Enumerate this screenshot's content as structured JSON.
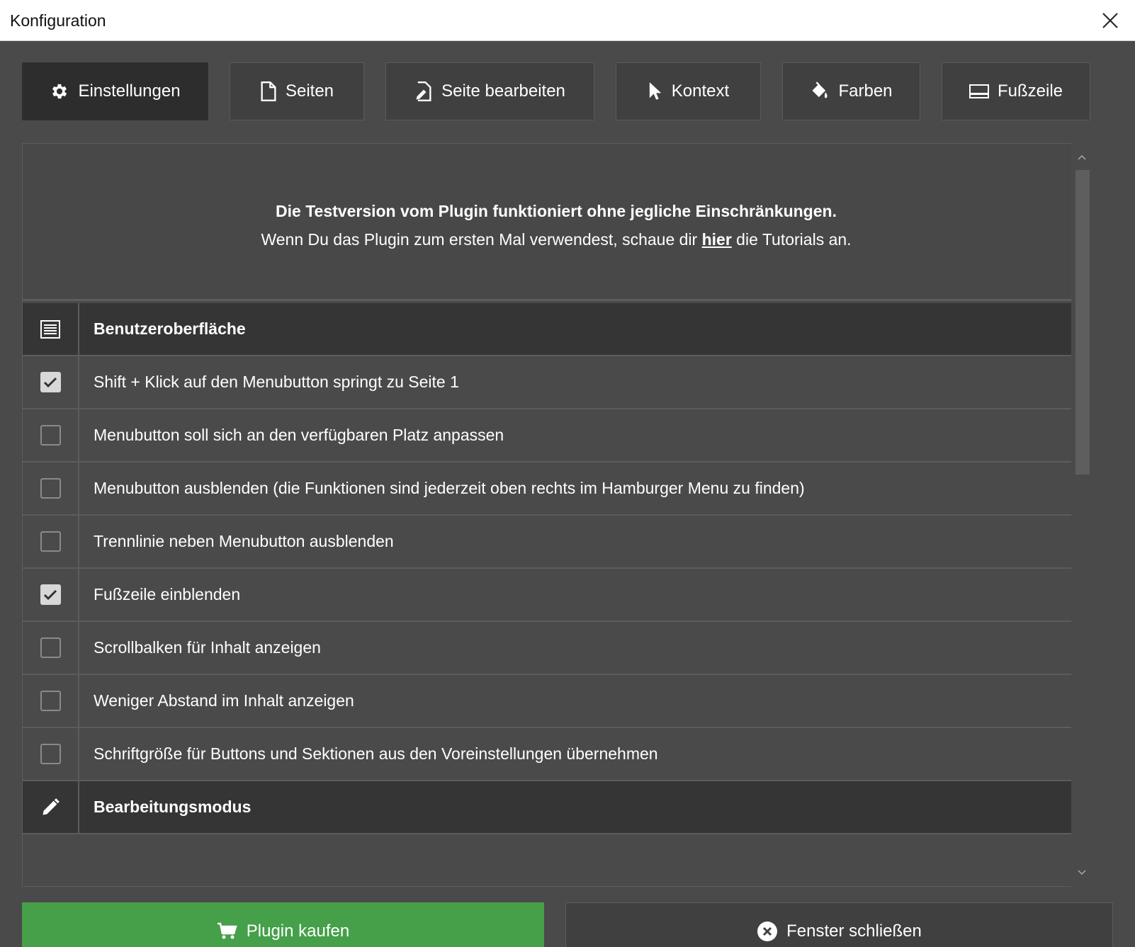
{
  "window": {
    "title": "Konfiguration"
  },
  "tabs": [
    {
      "label": "Einstellungen",
      "icon": "gear-icon",
      "active": true
    },
    {
      "label": "Seiten",
      "icon": "page-icon"
    },
    {
      "label": "Seite bearbeiten",
      "icon": "page-edit-icon"
    },
    {
      "label": "Kontext",
      "icon": "cursor-icon"
    },
    {
      "label": "Farben",
      "icon": "paint-bucket-icon"
    },
    {
      "label": "Fußzeile",
      "icon": "footer-icon"
    }
  ],
  "info": {
    "line1": "Die Testversion vom Plugin funktioniert ohne jegliche Einschränkungen.",
    "line2_before": "Wenn Du das Plugin zum ersten Mal verwendest, schaue dir ",
    "line2_link": "hier",
    "line2_after": " die Tutorials an."
  },
  "sections": [
    {
      "title": "Benutzeroberfläche",
      "icon": "list-icon",
      "items": [
        {
          "label": "Shift + Klick auf den Menubutton springt zu Seite 1",
          "checked": true
        },
        {
          "label": "Menubutton soll sich an den verfügbaren Platz anpassen",
          "checked": false
        },
        {
          "label": "Menubutton ausblenden (die Funktionen sind jederzeit oben rechts im Hamburger Menu zu finden)",
          "checked": false
        },
        {
          "label": "Trennlinie neben Menubutton ausblenden",
          "checked": false
        },
        {
          "label": "Fußzeile einblenden",
          "checked": true
        },
        {
          "label": "Scrollbalken für Inhalt anzeigen",
          "checked": false
        },
        {
          "label": "Weniger Abstand im Inhalt anzeigen",
          "checked": false
        },
        {
          "label": "Schriftgröße für Buttons und Sektionen aus den Voreinstellungen übernehmen",
          "checked": false
        }
      ]
    },
    {
      "title": "Bearbeitungsmodus",
      "icon": "pencil-icon",
      "items": []
    }
  ],
  "buttons": {
    "buy_label": "Plugin kaufen",
    "close_label": "Fenster schließen"
  },
  "colors": {
    "buy": "#45a049",
    "background": "#4a4a4a",
    "section": "#353535"
  }
}
